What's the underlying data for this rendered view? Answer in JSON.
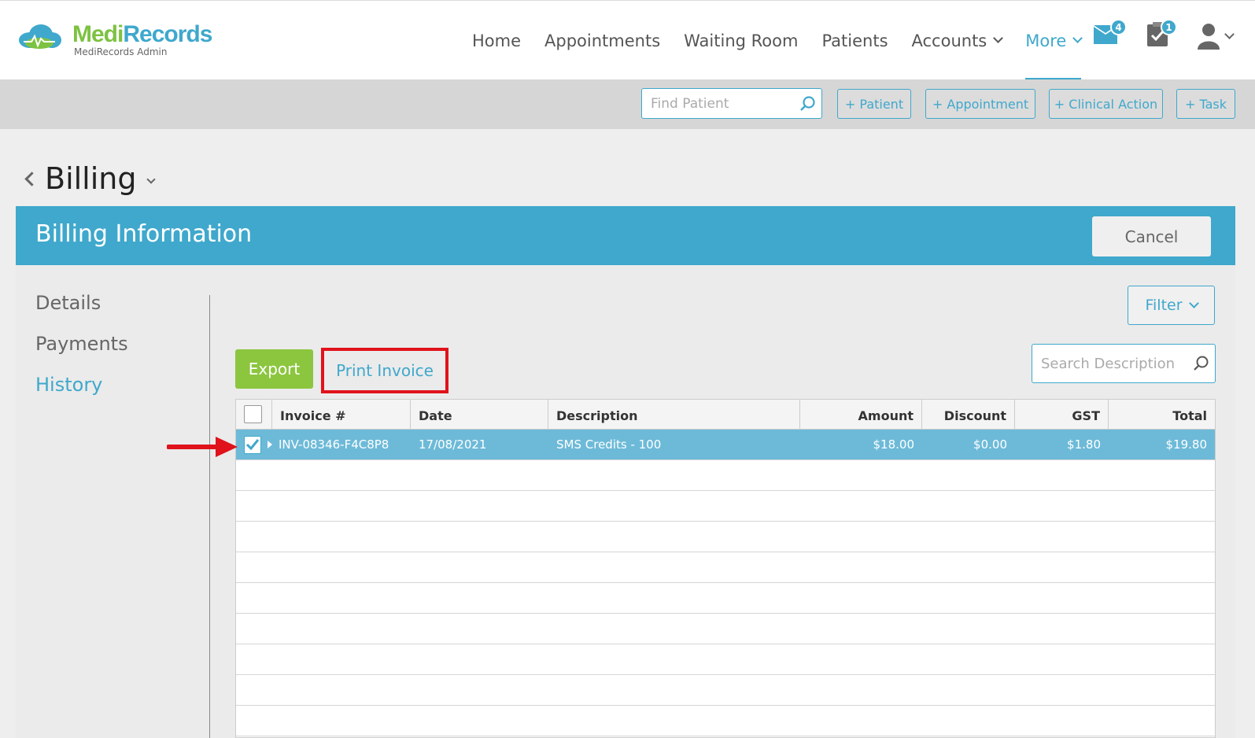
{
  "brand": {
    "name_part1": "Medi",
    "name_part2": "Records",
    "subtitle": "MediRecords Admin",
    "color_green": "#7dc242",
    "color_blue": "#3fa8cc"
  },
  "nav": {
    "items": [
      {
        "label": "Home"
      },
      {
        "label": "Appointments"
      },
      {
        "label": "Waiting Room"
      },
      {
        "label": "Patients"
      },
      {
        "label": "Accounts"
      },
      {
        "label": "More"
      }
    ],
    "mail_badge": "4",
    "tasks_badge": "1"
  },
  "actionbar": {
    "find_placeholder": "Find Patient",
    "buttons": [
      "+ Patient",
      "+ Appointment",
      "+ Clinical Action",
      "+ Task"
    ]
  },
  "page": {
    "title": "Billing"
  },
  "billing": {
    "header": "Billing Information",
    "cancel_label": "Cancel",
    "sidenav": [
      "Details",
      "Payments",
      "History"
    ],
    "filter_label": "Filter",
    "export_label": "Export",
    "print_label": "Print Invoice",
    "search_placeholder": "Search Description",
    "columns": [
      "Invoice #",
      "Date",
      "Description",
      "Amount",
      "Discount",
      "GST",
      "Total"
    ],
    "rows": [
      {
        "invoice": "INV-08346-F4C8P8",
        "date": "17/08/2021",
        "description": "SMS Credits - 100",
        "amount": "$18.00",
        "discount": "$0.00",
        "gst": "$1.80",
        "total": "$19.80",
        "checked": true
      }
    ]
  },
  "colors": {
    "accent": "#3fa8cc",
    "export_green": "#8cc63f",
    "highlight_red": "#e0121b",
    "selected_row": "#6dbad8"
  }
}
